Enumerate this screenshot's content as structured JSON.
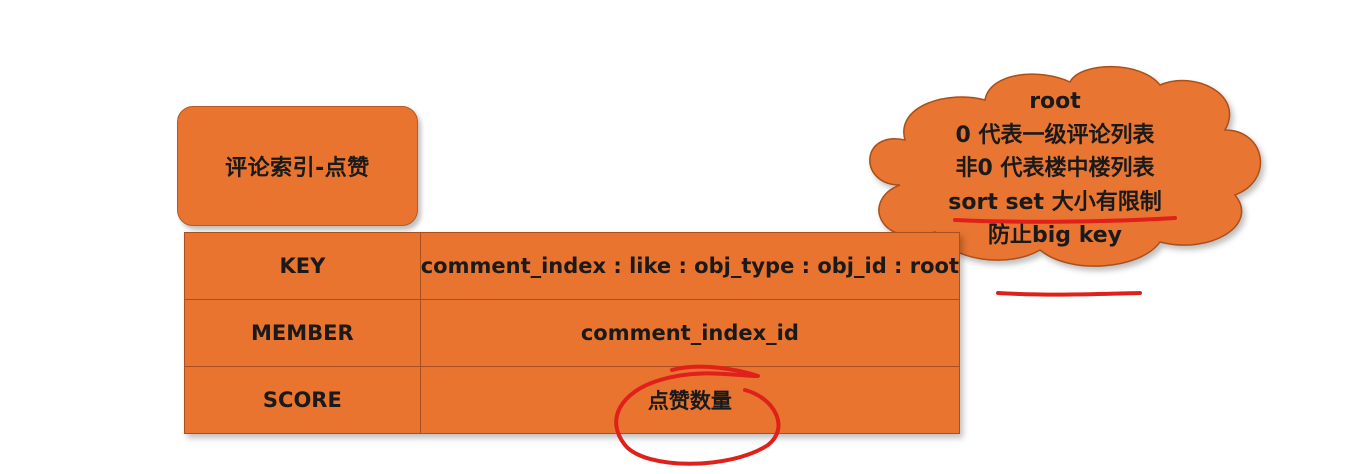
{
  "title_box": {
    "label": "评论索引-点赞"
  },
  "table": {
    "rows": [
      {
        "key": "KEY",
        "value": "comment_index : like : obj_type : obj_id : root"
      },
      {
        "key": "MEMBER",
        "value": "comment_index_id"
      },
      {
        "key": "SCORE",
        "value": "点赞数量"
      }
    ]
  },
  "cloud_note": {
    "lines": [
      "root",
      "0 代表一级评论列表",
      "非0 代表楼中楼列表",
      "sort set 大小有限制",
      "防止big key"
    ]
  },
  "colors": {
    "box_fill": "#e87430",
    "annotation_red": "#e0201b"
  }
}
